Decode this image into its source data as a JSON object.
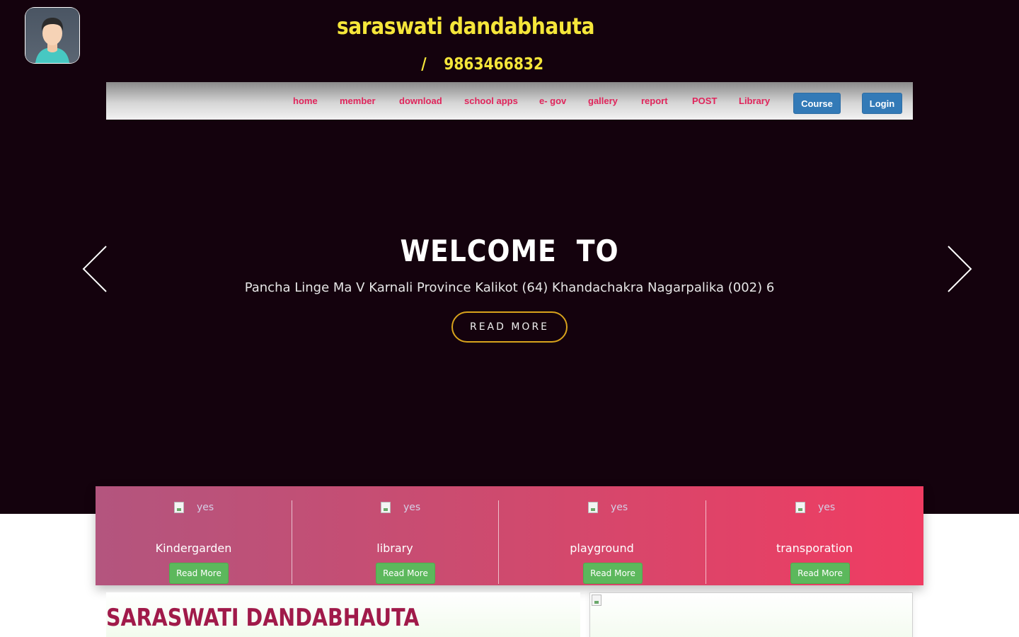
{
  "header": {
    "site_title": "saraswati dandabhauta",
    "phone_separator": "/",
    "phone": "9863466832",
    "logo_icon": "user-avatar-icon"
  },
  "nav": {
    "items": [
      {
        "label": "home"
      },
      {
        "label": "member"
      },
      {
        "label": "download"
      },
      {
        "label": "school apps"
      },
      {
        "label": "e- gov"
      },
      {
        "label": "gallery"
      },
      {
        "label": "report"
      },
      {
        "label": "POST"
      },
      {
        "label": "Library"
      }
    ],
    "course_label": "Course",
    "login_label": "Login"
  },
  "hero": {
    "heading": "WELCOME  TO",
    "address": "Pancha Linge Ma V Karnali Province Kalikot (64) Khandachakra Nagarpalika (002) 6",
    "button_label": "READ MORE",
    "prev_icon": "chevron-left-icon",
    "next_icon": "chevron-right-icon"
  },
  "features": [
    {
      "img_alt": "yes",
      "title": "Kindergarden",
      "button": "Read More"
    },
    {
      "img_alt": "yes",
      "title": "library",
      "button": "Read More"
    },
    {
      "img_alt": "yes",
      "title": "playground",
      "button": "Read More"
    },
    {
      "img_alt": "yes",
      "title": "transporation",
      "button": "Read More"
    }
  ],
  "about": {
    "title": "SARASWATI DANDABHAUTA"
  },
  "colors": {
    "hero_bg": "#14020d",
    "title_yellow": "#f5e63a",
    "nav_text": "#e0245b",
    "primary_button": "#337ab7",
    "success_button": "#5cb85c",
    "about_title": "#a01a4a"
  }
}
